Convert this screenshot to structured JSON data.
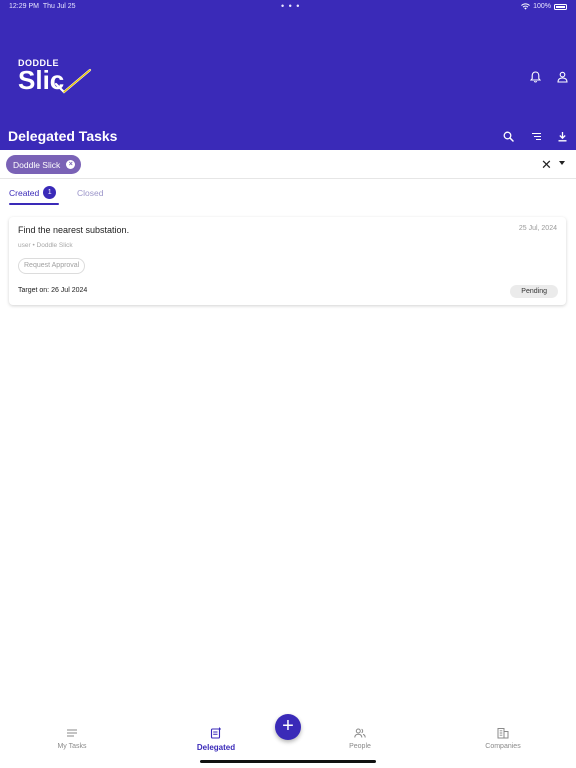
{
  "status_bar": {
    "time": "12:29 PM",
    "date": "Thu Jul 25",
    "dots": "• • •",
    "battery": "100%"
  },
  "brand": {
    "small": "DODDLE",
    "big": "Slic"
  },
  "header": {
    "title": "Delegated Tasks"
  },
  "icons": {
    "bell": "bell-icon",
    "profile": "person-icon",
    "search": "search-icon",
    "filter": "filter-icon",
    "download": "download-icon"
  },
  "filter": {
    "chip_label": "Doddle Slick",
    "clear": "✕"
  },
  "tabs": [
    {
      "label": "Created",
      "count": "1"
    },
    {
      "label": "Closed"
    }
  ],
  "tasks": [
    {
      "title": "Find the nearest substation.",
      "date": "25 Jul, 2024",
      "subtitle": "user • Doddle Slick",
      "action": "Request Approval",
      "target": "Target on: 26 Jul 2024",
      "status": "Pending"
    }
  ],
  "nav": {
    "items": [
      "My Tasks",
      "Delegated",
      "People",
      "Companies"
    ],
    "fab": "+"
  },
  "colors": {
    "primary": "#3a2ab8",
    "chip": "#7a62b6",
    "accent_check": "#e8c400"
  }
}
